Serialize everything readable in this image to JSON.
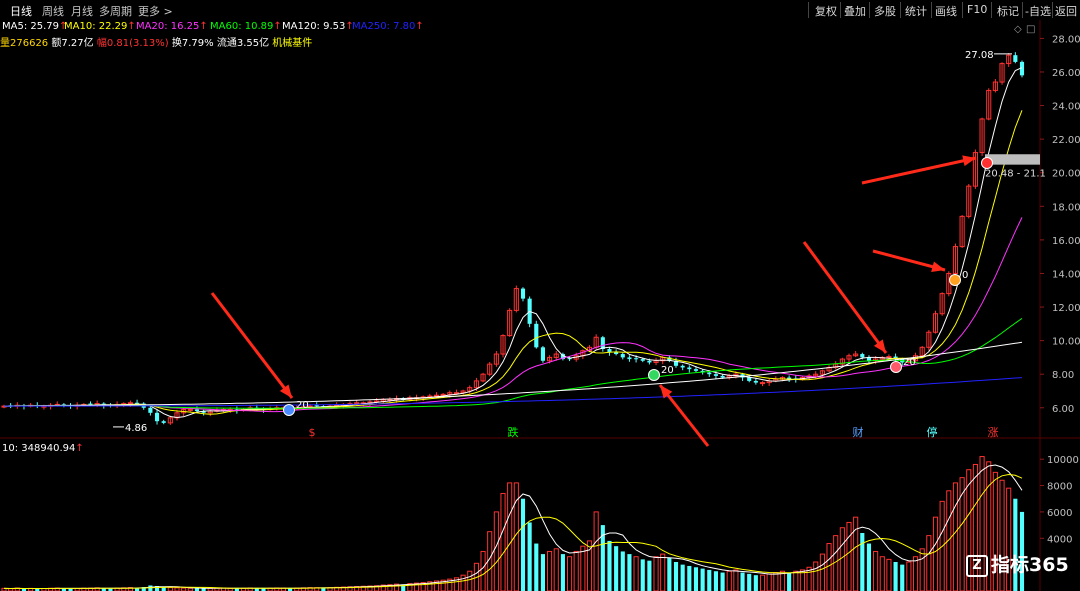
{
  "periods": [
    {
      "label": "日线",
      "active": true
    },
    {
      "label": "周线",
      "active": false
    },
    {
      "label": "月线",
      "active": false
    },
    {
      "label": "多周期",
      "active": false
    },
    {
      "label": "更多 >",
      "active": false
    }
  ],
  "tools": [
    "复权",
    "叠加",
    "多股",
    "统计",
    "画线",
    "F10",
    "标记",
    "-自选",
    "返回"
  ],
  "ma_legend": [
    {
      "label": "MA5: 25.79",
      "arrow": "↑",
      "color": "#ffffff"
    },
    {
      "label": "MA10: 22.29",
      "arrow": "↑",
      "color": "#ffff00"
    },
    {
      "label": "MA20: 16.25",
      "arrow": "↑",
      "color": "#ff33ff"
    },
    {
      "label": "MA60: 10.89",
      "arrow": "↑",
      "color": "#00ff00"
    },
    {
      "label": "MA120: 9.53",
      "arrow": "↑",
      "color": "#ffffff"
    },
    {
      "label": "MA250: 7.80",
      "arrow": "↑",
      "color": "#2222ff"
    }
  ],
  "info": {
    "volume": "量276626",
    "amount": "额7.27亿",
    "change": "幅0.81(3.13%)",
    "turnover": "换7.79%",
    "float": "流通3.55亿",
    "sector": "机械基件"
  },
  "colors": {
    "up": "#ff3232",
    "down": "#54ffff",
    "ma5": "#ffffff",
    "ma10": "#ffff00",
    "ma20": "#ff33ff",
    "ma60": "#00ff00",
    "ma120": "#ffffff",
    "ma250": "#2222ff",
    "arrow": "#ff2a1a",
    "grid": "#5a0000"
  },
  "annotations": {
    "high": "27.08",
    "low": "4.86",
    "range": "20.48 - 21.1"
  },
  "event_labels": [
    {
      "text": "$",
      "color": "#ff3232"
    },
    {
      "text": "跌",
      "color": "#00ff00"
    },
    {
      "text": "财",
      "color": "#5aa0ff"
    },
    {
      "text": "停",
      "color": "#54ffff"
    },
    {
      "text": "涨",
      "color": "#ff3232"
    }
  ],
  "signal_labels": [
    "20",
    "20",
    "20",
    "0"
  ],
  "volume_legend": {
    "label": "10: 348940.94",
    "arrow": "↑"
  },
  "watermark": "指标365",
  "chart_data": [
    {
      "type": "candlestick",
      "title": "",
      "ylim": [
        4.2,
        28.5
      ],
      "y_ticks": [
        "28.00",
        "26.00",
        "24.00",
        "22.00",
        "20.00",
        "18.00",
        "16.00",
        "14.00",
        "12.00",
        "10.00",
        "8.00",
        "6.00"
      ],
      "closes": [
        6.1,
        6.1,
        6.15,
        6.1,
        6.15,
        6.1,
        6.1,
        6.15,
        6.2,
        6.15,
        6.1,
        6.15,
        6.2,
        6.2,
        6.25,
        6.15,
        6.1,
        6.2,
        6.25,
        6.3,
        6.25,
        6.0,
        5.7,
        5.2,
        5.1,
        5.4,
        5.7,
        5.9,
        5.9,
        5.8,
        5.7,
        5.8,
        5.85,
        5.9,
        5.9,
        5.85,
        5.9,
        6.0,
        5.95,
        5.9,
        5.95,
        6.0,
        6.0,
        5.95,
        6.0,
        6.05,
        6.1,
        6.1,
        6.05,
        6.1,
        6.15,
        6.2,
        6.25,
        6.3,
        6.3,
        6.35,
        6.4,
        6.5,
        6.5,
        6.55,
        6.5,
        6.6,
        6.6,
        6.65,
        6.7,
        6.75,
        6.8,
        6.9,
        6.9,
        7.0,
        7.2,
        7.6,
        8.0,
        8.6,
        9.2,
        10.3,
        11.8,
        13.1,
        12.5,
        11.0,
        9.6,
        8.8,
        9.0,
        9.2,
        8.9,
        8.9,
        9.1,
        9.4,
        9.6,
        10.2,
        9.5,
        9.3,
        9.2,
        9.0,
        8.9,
        8.9,
        8.8,
        8.7,
        8.8,
        9.0,
        8.8,
        8.5,
        8.4,
        8.3,
        8.2,
        8.1,
        8.0,
        7.9,
        7.8,
        7.9,
        8.0,
        7.8,
        7.6,
        7.5,
        7.5,
        7.6,
        7.7,
        7.8,
        7.7,
        7.7,
        7.8,
        7.9,
        8.0,
        8.2,
        8.4,
        8.6,
        8.9,
        9.1,
        9.2,
        9.0,
        8.8,
        8.9,
        9.0,
        9.05,
        8.9,
        8.7,
        8.8,
        9.1,
        9.6,
        10.5,
        11.6,
        12.8,
        14.0,
        15.6,
        17.4,
        19.2,
        21.2,
        23.2,
        24.9,
        25.4,
        26.5,
        27.0,
        26.6,
        25.8
      ],
      "extremes": {
        "high": 27.08,
        "low": 4.86
      },
      "series_names": [
        "MA5",
        "MA10",
        "MA20",
        "MA60",
        "MA120",
        "MA250"
      ]
    },
    {
      "type": "bar",
      "title": "",
      "ylim": [
        0,
        11000
      ],
      "y_ticks": [
        "10000",
        "8000",
        "6000",
        "4000"
      ],
      "values": [
        200,
        180,
        220,
        160,
        200,
        180,
        190,
        210,
        220,
        200,
        180,
        190,
        210,
        220,
        240,
        200,
        180,
        220,
        240,
        260,
        230,
        300,
        420,
        380,
        300,
        260,
        240,
        220,
        210,
        200,
        190,
        200,
        210,
        220,
        200,
        190,
        200,
        230,
        210,
        200,
        210,
        230,
        220,
        200,
        220,
        240,
        260,
        250,
        240,
        260,
        280,
        300,
        320,
        340,
        360,
        380,
        400,
        450,
        480,
        520,
        500,
        560,
        600,
        640,
        700,
        760,
        820,
        900,
        1000,
        1200,
        1500,
        2100,
        3000,
        4500,
        6000,
        7400,
        8200,
        8200,
        7000,
        5200,
        3600,
        2800,
        3000,
        3200,
        2800,
        2600,
        3000,
        3400,
        3800,
        6000,
        5000,
        3800,
        3400,
        3000,
        2800,
        2600,
        2400,
        2300,
        2600,
        2800,
        2500,
        2200,
        2000,
        1900,
        1800,
        1700,
        1600,
        1500,
        1400,
        1500,
        1600,
        1400,
        1300,
        1200,
        1200,
        1300,
        1400,
        1500,
        1400,
        1500,
        1600,
        1800,
        2200,
        2800,
        3600,
        4200,
        4800,
        5200,
        5600,
        4400,
        3600,
        3000,
        2600,
        2400,
        2200,
        2000,
        2200,
        2600,
        3200,
        4200,
        5600,
        6800,
        7600,
        8200,
        8600,
        9200,
        9600,
        10200,
        9800,
        9000,
        8400,
        7800,
        7000,
        6000
      ]
    }
  ]
}
